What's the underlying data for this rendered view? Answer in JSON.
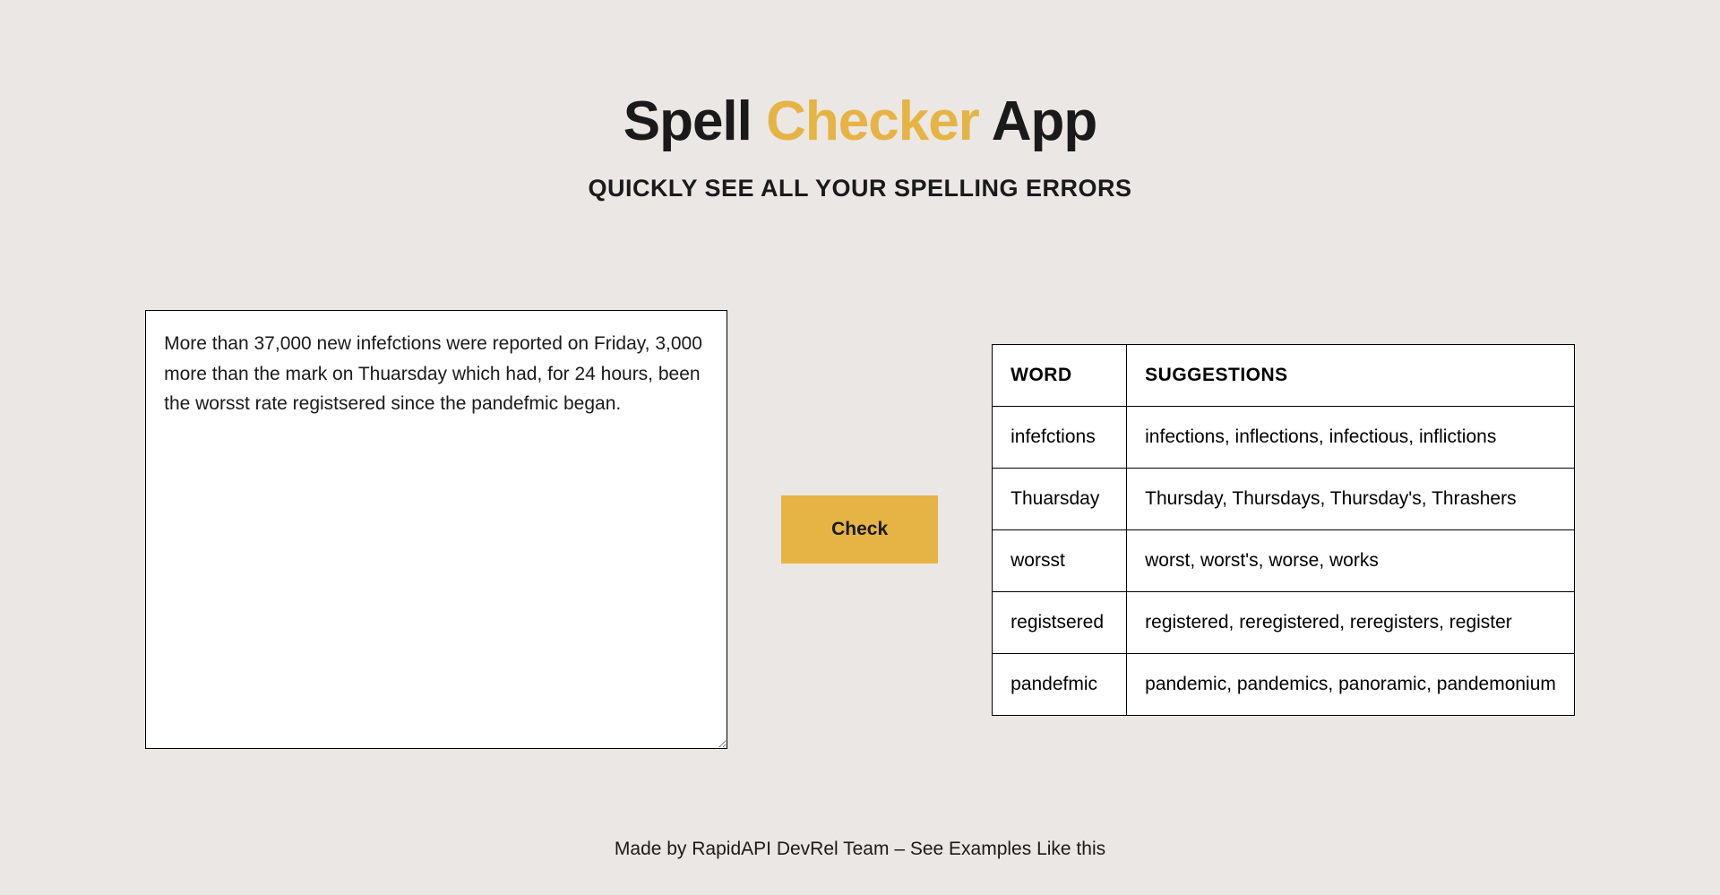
{
  "header": {
    "title_part1": "Spell ",
    "title_accent": "Checker",
    "title_part2": " App",
    "subtitle": "QUICKLY SEE ALL YOUR SPELLING ERRORS"
  },
  "input": {
    "text": "More than 37,000 new infefctions were reported on Friday, 3,000 more than the mark on Thuarsday which had, for 24 hours, been the worsst rate registsered since the pandefmic began."
  },
  "button": {
    "check_label": "Check"
  },
  "results": {
    "header_word": "WORD",
    "header_suggestions": "SUGGESTIONS",
    "rows": [
      {
        "word": "infefctions",
        "suggestions": "infections, inflections, infectious, inflictions"
      },
      {
        "word": "Thuarsday",
        "suggestions": "Thursday, Thursdays, Thursday's, Thrashers"
      },
      {
        "word": "worsst",
        "suggestions": "worst, worst's, worse, works"
      },
      {
        "word": "registsered",
        "suggestions": "registered, reregistered, reregisters, register"
      },
      {
        "word": "pandefmic",
        "suggestions": "pandemic, pandemics, panoramic, pandemonium"
      }
    ]
  },
  "footer": {
    "text": "Made by RapidAPI DevRel Team – See Examples Like this"
  }
}
